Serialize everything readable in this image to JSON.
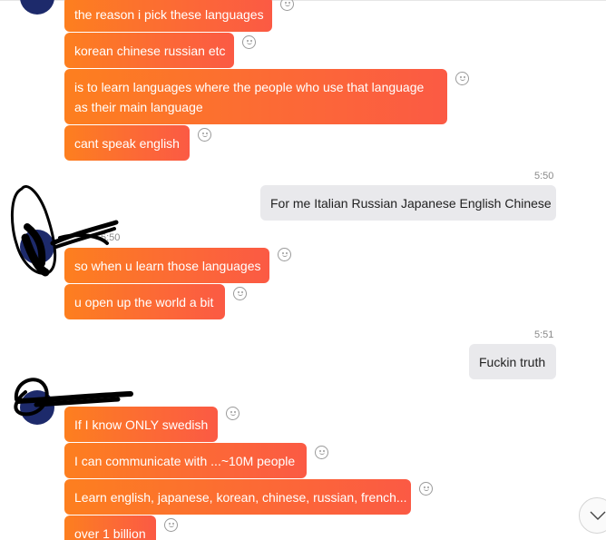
{
  "chat": {
    "group1": [
      "the reason i pick these languages",
      "korean chinese russian etc",
      "is to learn languages where the people who use that language as their main language",
      "cant speak english"
    ],
    "time1": "5:50",
    "me1": "For me Italian Russian Japanese English Chinese",
    "time2": "5:50",
    "group2": [
      "so when u learn those languages",
      "u open up the world a bit"
    ],
    "time3": "5:51",
    "me2": "Fuckin truth",
    "group3": [
      "If I know ONLY swedish",
      "I can communicate with ...~10M people",
      "Learn english, japanese, korean, chinese, russian, french...",
      "over 1 billion"
    ]
  },
  "icons": {
    "reaction": "smiley-reaction-icon",
    "scroll": "chevron-down-icon"
  },
  "colors": {
    "bubble_start": "#fd7f1f",
    "bubble_end": "#fb5a44",
    "my_bubble": "#e9e9ec"
  }
}
